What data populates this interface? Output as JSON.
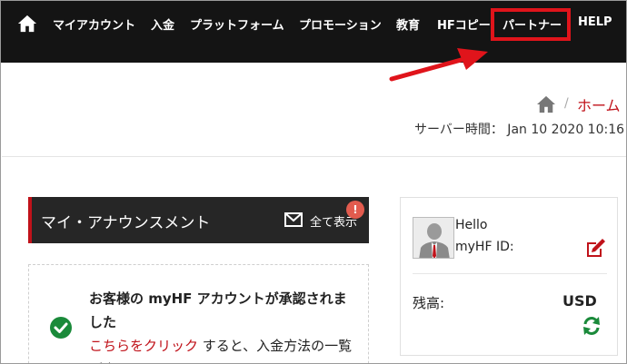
{
  "nav": {
    "items": [
      {
        "label": "マイアカウント"
      },
      {
        "label": "入金"
      },
      {
        "label": "プラットフォーム"
      },
      {
        "label": "プロモーション"
      },
      {
        "label": "教育"
      },
      {
        "label": "HFコピー"
      },
      {
        "label": "パートナー"
      },
      {
        "label": "HELP"
      }
    ],
    "highlight_color": "#e0141b"
  },
  "breadcrumb": {
    "current": "ホーム",
    "separator": "/"
  },
  "server_time": {
    "text": "サーバー時間： Jan 10 2020 10:16"
  },
  "announcements": {
    "title": "マイ・アナウンスメント",
    "show_all": "全て表示",
    "badge": "!",
    "message_bold": "お客様の myHF アカウントが承認されました",
    "message_link": "こちらをクリック",
    "message_rest": " すると、入金方法の一覧が表示されます"
  },
  "profile": {
    "hello": "Hello",
    "id_label": "myHF ID:",
    "balance_label": "残高:",
    "currency": "USD"
  },
  "colors": {
    "nav_bg": "#141414",
    "accent_red": "#c0121a",
    "success_green": "#1a8a3a"
  }
}
